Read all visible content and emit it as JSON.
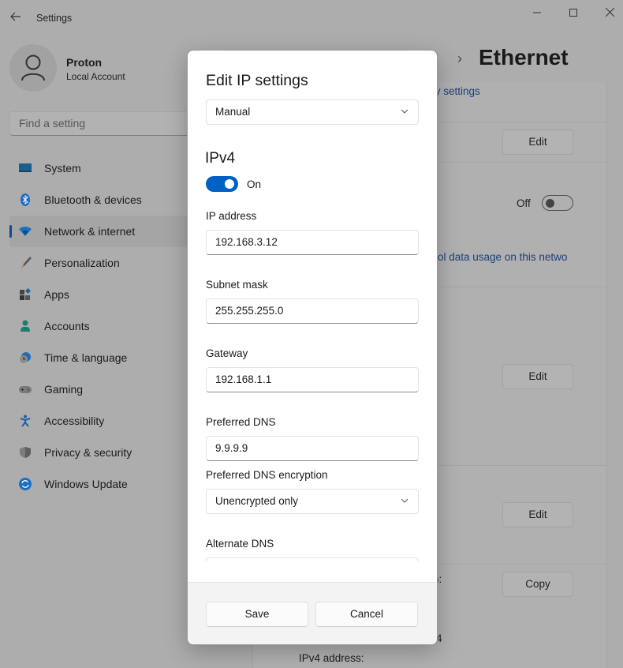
{
  "window": {
    "title": "Settings",
    "back_icon": "arrow-left",
    "minimize_icon": "—",
    "maximize_icon": "☐",
    "close_icon": "✕"
  },
  "profile": {
    "name": "Proton",
    "account_type": "Local Account"
  },
  "search": {
    "placeholder": "Find a setting"
  },
  "sidebar": {
    "items": [
      {
        "label": "System",
        "icon": "system-icon",
        "active": false
      },
      {
        "label": "Bluetooth & devices",
        "icon": "bluetooth-icon",
        "active": false
      },
      {
        "label": "Network & internet",
        "icon": "wifi-icon",
        "active": true
      },
      {
        "label": "Personalization",
        "icon": "brush-icon",
        "active": false
      },
      {
        "label": "Apps",
        "icon": "apps-icon",
        "active": false
      },
      {
        "label": "Accounts",
        "icon": "accounts-icon",
        "active": false
      },
      {
        "label": "Time & language",
        "icon": "clock-globe-icon",
        "active": false
      },
      {
        "label": "Gaming",
        "icon": "gamepad-icon",
        "active": false
      },
      {
        "label": "Accessibility",
        "icon": "accessibility-icon",
        "active": false
      },
      {
        "label": "Privacy & security",
        "icon": "shield-icon",
        "active": false
      },
      {
        "label": "Windows Update",
        "icon": "update-icon",
        "active": false
      }
    ]
  },
  "main": {
    "breadcrumb_partial": "t",
    "breadcrumb_separator": "›",
    "page_title": "Ethernet",
    "link_security_partial": "ty settings",
    "edit_button_1": "Edit",
    "metered_state": "Off",
    "link_data_usage_partial": "ol data usage on this netwo",
    "edit_button_2": "Edit",
    "edit_button_3": "Edit",
    "copy_button": "Copy",
    "partial_label_1": "):",
    "partial_label_2": "4",
    "ipv4_address_label": "IPv4 address:"
  },
  "dialog": {
    "title": "Edit IP settings",
    "mode_select": "Manual",
    "section": "IPv4",
    "ipv4_toggle": {
      "state": "On",
      "on": true
    },
    "fields": {
      "ip_address": {
        "label": "IP address",
        "value": "192.168.3.12"
      },
      "subnet_mask": {
        "label": "Subnet mask",
        "value": "255.255.255.0"
      },
      "gateway": {
        "label": "Gateway",
        "value": "192.168.1.1"
      },
      "preferred_dns": {
        "label": "Preferred DNS",
        "value": "9.9.9.9"
      },
      "preferred_dns_encryption": {
        "label": "Preferred DNS encryption",
        "value": "Unencrypted only"
      },
      "alternate_dns": {
        "label": "Alternate DNS",
        "value": ""
      }
    },
    "save_label": "Save",
    "cancel_label": "Cancel"
  },
  "colors": {
    "accent": "#0061c4",
    "link": "#1c3f78",
    "overlay_bg": "#adadad"
  }
}
